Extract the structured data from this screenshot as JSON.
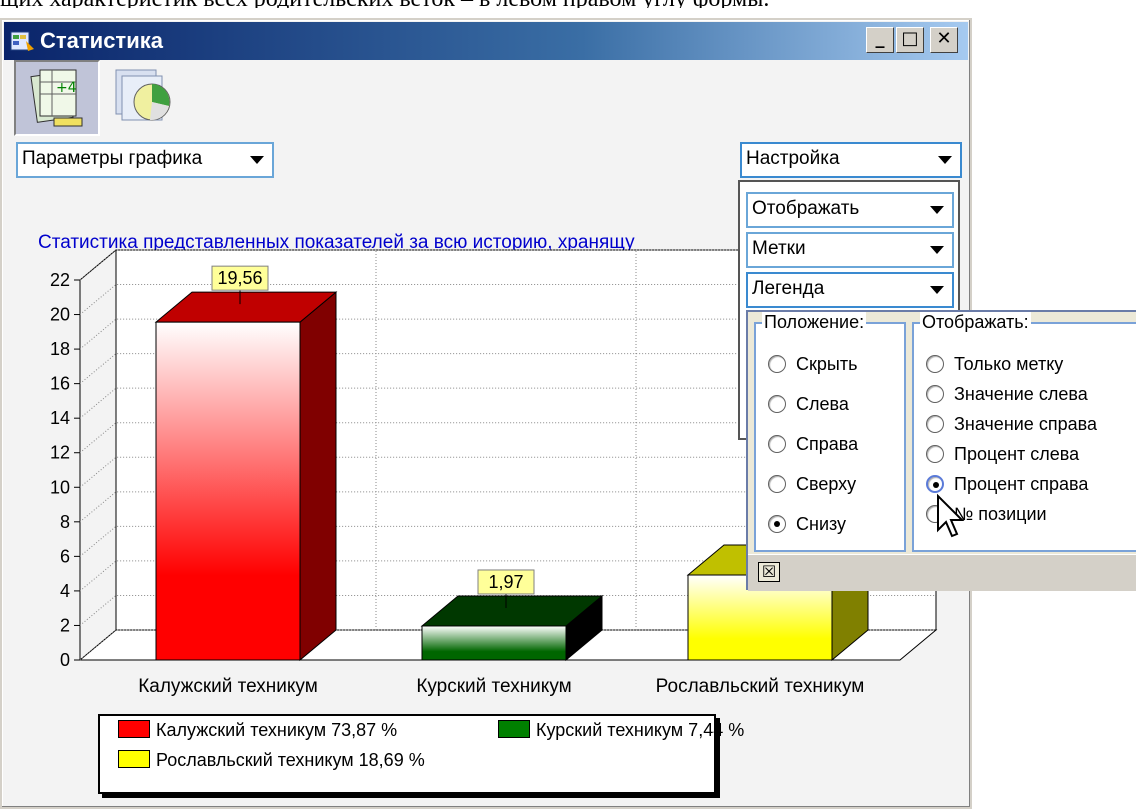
{
  "document": {
    "text": "щих характеристик всех родительских веток – в левом правом углу формы."
  },
  "window": {
    "title": "Статистика",
    "buttons": {
      "minimize": "_",
      "maximize": "□",
      "close": "✕"
    }
  },
  "toolbar": {
    "items": [
      {
        "icon": "table-calc-icon",
        "pressed": true
      },
      {
        "icon": "pie-chart-icon",
        "pressed": false
      }
    ]
  },
  "controls": {
    "graph_params": "Параметры графика",
    "settings": "Настройка",
    "settings_menu": [
      "Отображать",
      "Метки",
      "Легенда"
    ]
  },
  "legend_popup": {
    "position_group": {
      "label": "Положение:",
      "options": [
        "Скрыть",
        "Слева",
        "Справа",
        "Сверху",
        "Снизу"
      ],
      "selected": "Снизу"
    },
    "display_group": {
      "label": "Отображать:",
      "options": [
        "Только метку",
        "Значение слева",
        "Значение справа",
        "Процент слева",
        "Процент справа",
        "№ позиции"
      ],
      "selected": "Процент справа"
    },
    "close_label": "☒"
  },
  "chart_data": {
    "type": "bar",
    "title": "Статистика представленных показателей за всю историю, хранящу",
    "categories": [
      "Калужский техникум",
      "Курский техникум",
      "Рославльский техникум"
    ],
    "values": [
      19.56,
      1.97,
      4.92
    ],
    "data_labels": [
      "19,56",
      "1,97",
      ""
    ],
    "yticks": [
      "0",
      "2",
      "4",
      "6",
      "8",
      "10",
      "12",
      "14",
      "16",
      "18",
      "20",
      "22"
    ],
    "ylim": [
      0,
      22
    ],
    "colors": [
      "#ff0000",
      "#006600",
      "#ffff00"
    ],
    "side_colors": [
      "#800000",
      "#000000",
      "#808000"
    ],
    "legend": [
      {
        "label": "Калужский техникум 73,87 %",
        "color": "#ff0000"
      },
      {
        "label": "Курский техникум 7,44 %",
        "color": "#008000"
      },
      {
        "label": "Рославльский техникум 18,69 %",
        "color": "#ffff00"
      }
    ],
    "legend_position": "bottom",
    "grid": true
  }
}
